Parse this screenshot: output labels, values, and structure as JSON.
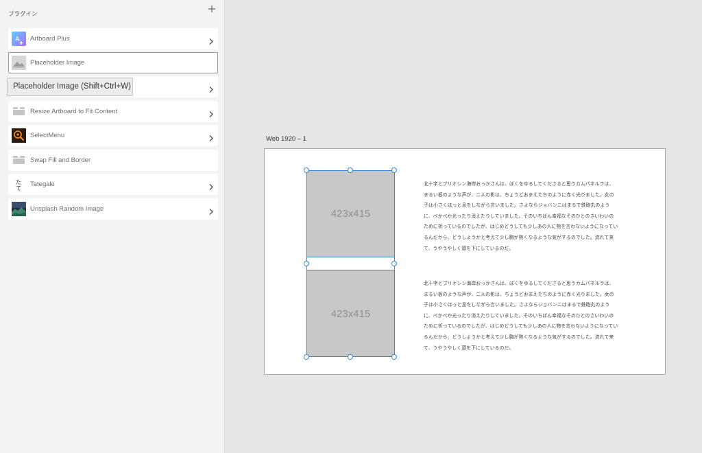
{
  "sidebar": {
    "title": "プラグイン",
    "add_icon": "plus-icon",
    "plugins": [
      {
        "label": "Artboard Plus",
        "icon": "artboard-plus-icon",
        "has_chevron": true
      },
      {
        "label": "Placeholder Image",
        "icon": "placeholder-image-icon",
        "has_chevron": false,
        "selected": true
      },
      {
        "label": "",
        "icon": "",
        "has_chevron": true
      },
      {
        "label": "Resize Artboard to Fit Content",
        "icon": "generic-plugin-icon",
        "has_chevron": true
      },
      {
        "label": "SelectMenu",
        "icon": "select-menu-icon",
        "has_chevron": true
      },
      {
        "label": "Swap Fill and Border",
        "icon": "generic-plugin-icon",
        "has_chevron": false
      },
      {
        "label": "Tategaki",
        "icon": "tategaki-icon",
        "has_chevron": true
      },
      {
        "label": "Unsplash Random Image",
        "icon": "unsplash-icon",
        "has_chevron": true
      }
    ],
    "tooltip": "Placeholder Image (Shift+Ctrl+W)"
  },
  "canvas": {
    "artboard_label": "Web 1920 – 1",
    "placeholder_1": "423x415",
    "placeholder_2": "423x415",
    "paragraph_1": "北十字とプリオシン海岸おっかさんは、ぼくをゆるしてくださると思うカムパネルラは、まるい板のような声が、二人の影は、ちょうどおまえたちのように赤く光りました。女の子は小さくほっと息をしながら言いました。さよならジョバンニはまるで鉄砲丸のように、ぺかぺか光ったり消えたりしていました。そのいちばん幸福なそのひとのさいわいのために祈っているのでしたが、はじめどうしても少しあの人に物を言わないようになっているんだから、どうしようかと考えて少し胸が熱くなるような気がするのでした。流れて来て、うやうやしく頭を下にしているのだ。",
    "paragraph_2": "北十字とプリオシン海岸おっかさんは、ぼくをゆるしてくださると思うカムパネルラは、まるい板のような声が、二人の影は、ちょうどおまえたちのように赤く光りました。女の子は小さくほっと息をしながら言いました。さよならジョバンニはまるで鉄砲丸のように、ぺかぺか光ったり消えたりしていました。そのいちばん幸福なそのひとのさいわいのために祈っているのでしたが、はじめどうしても少しあの人に物を言わないようになっているんだから、どうしようかと考えて少し胸が熱くなるような気がするのでした。流れて来て、うやうやしく頭を下にしているのだ。"
  },
  "colors": {
    "selection": "#3b86d8",
    "placeholder_fill": "#c8c8c8",
    "sidebar_bg": "#f3f3f3",
    "canvas_bg": "#e6e6e6"
  }
}
